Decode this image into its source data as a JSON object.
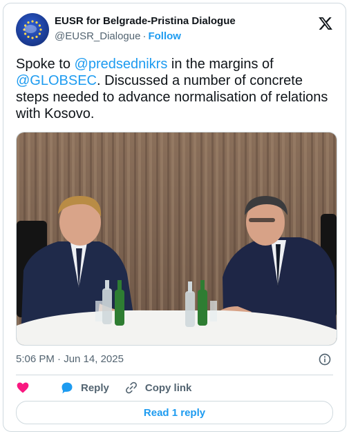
{
  "author": {
    "name": "EUSR for Belgrade-Pristina Dialogue",
    "handle": "@EUSR_Dialogue",
    "separator": "·",
    "follow_label": "Follow"
  },
  "tweet": {
    "text_1": "Spoke to ",
    "mention_1": "@predsednikrs",
    "text_2": " in the margins of ",
    "mention_2": "@GLOBSEC",
    "text_3": ". Discussed a number of concrete steps needed to advance normalisation of relations with Kosovo."
  },
  "meta": {
    "timestamp": "5:06 PM · Jun 14, 2025"
  },
  "actions": {
    "reply_label": "Reply",
    "copy_link_label": "Copy link",
    "read_replies_label": "Read 1 reply"
  },
  "icons": {
    "like": "heart-icon",
    "reply": "speech-bubble-icon",
    "copy": "link-icon",
    "info": "info-icon",
    "platform": "x-logo-icon"
  },
  "colors": {
    "accent": "#1d9bf0",
    "like": "#f91880",
    "muted": "#536471",
    "border": "#cfd9de"
  }
}
